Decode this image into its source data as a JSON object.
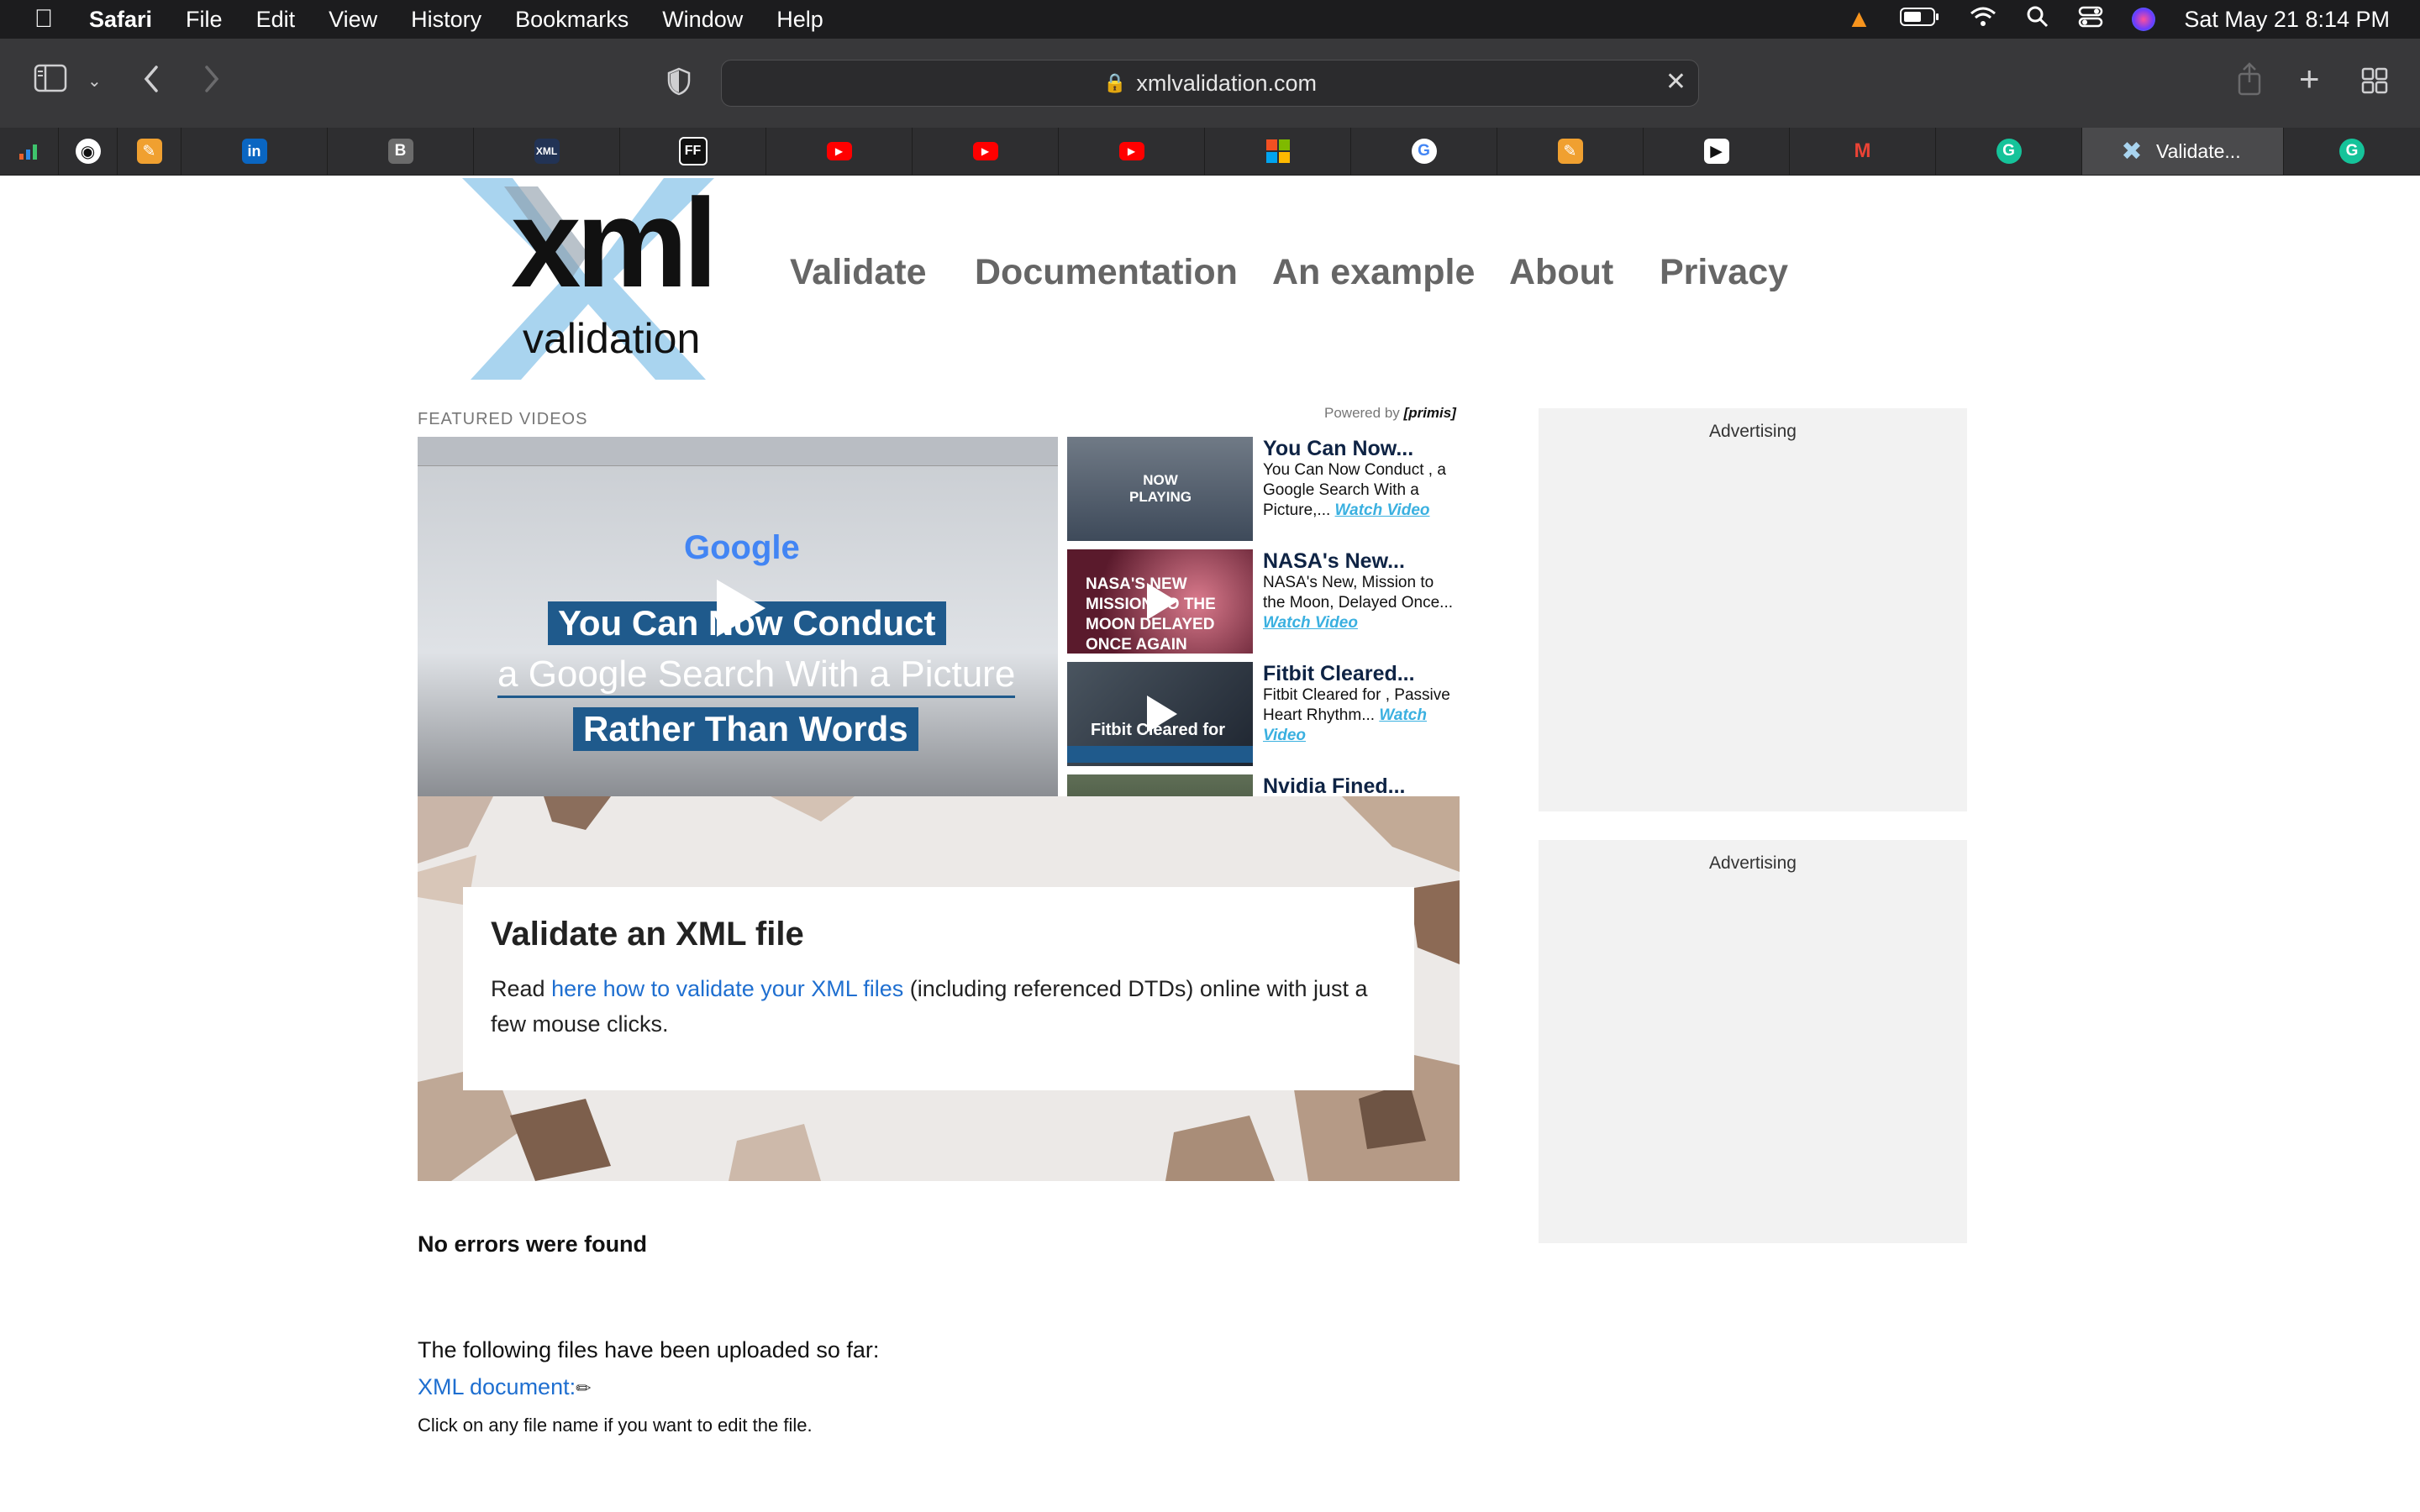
{
  "menubar": {
    "app": "Safari",
    "items": [
      "File",
      "Edit",
      "View",
      "History",
      "Bookmarks",
      "Window",
      "Help"
    ],
    "clock": "Sat May 21  8:14 PM"
  },
  "browser": {
    "url": "xmlvalidation.com",
    "active_tab_label": "Validate..."
  },
  "tabs": [
    {
      "icon": "chart-icon",
      "color": "#e8622d"
    },
    {
      "icon": "github-icon",
      "color": "#ffffff"
    },
    {
      "icon": "notepad-icon",
      "color": "#f0a030"
    },
    {
      "icon": "linkedin-icon",
      "color": "#0a66c2"
    },
    {
      "icon": "b-icon",
      "color": "#6b6b6b"
    },
    {
      "icon": "xml-icon",
      "color": "#223355"
    },
    {
      "icon": "ff-icon",
      "color": "#111111"
    },
    {
      "icon": "youtube-icon",
      "color": "#ff0000"
    },
    {
      "icon": "youtube-icon",
      "color": "#ff0000"
    },
    {
      "icon": "youtube-icon",
      "color": "#ff0000"
    },
    {
      "icon": "microsoft-icon",
      "color": "#f25022"
    },
    {
      "icon": "google-icon",
      "color": "#4285f4"
    },
    {
      "icon": "notepad-icon",
      "color": "#f0a030"
    },
    {
      "icon": "playstation-icon",
      "color": "#ffffff"
    },
    {
      "icon": "gmail-icon",
      "color": "#ea4335"
    },
    {
      "icon": "grammarly-icon",
      "color": "#15c39a"
    }
  ],
  "logo": {
    "big": "xml",
    "small": "validation"
  },
  "nav": [
    "Validate",
    "Documentation",
    "An example",
    "About",
    "Privacy"
  ],
  "videos": {
    "section_label": "FEATURED VIDEOS",
    "powered_by": "Powered by",
    "powered_brand": "primis",
    "main": {
      "brand": "Google",
      "line1": "You Can Now Conduct",
      "line2": "a Google Search With a Picture",
      "line3": "Rather Than Words"
    },
    "list": [
      {
        "title": "You Can Now...",
        "desc": "You Can Now Conduct , a Google Search With a Picture,...",
        "watch": "Watch Video",
        "thumb_text": "NOW PLAYING"
      },
      {
        "title": "NASA's New...",
        "desc": "NASA's New, Mission to the Moon, Delayed Once...",
        "watch": "Watch Video",
        "thumb_text": "NASA'S NEW MISSION TO THE MOON DELAYED ONCE AGAIN"
      },
      {
        "title": "Fitbit Cleared...",
        "desc": "Fitbit Cleared for , Passive Heart Rhythm...",
        "watch": "Watch Video",
        "thumb_text": "Fitbit Cleared for"
      },
      {
        "title": "Nvidia Fined...",
        "desc": "",
        "watch": "",
        "thumb_text": ""
      }
    ]
  },
  "hero": {
    "title": "Validate an XML file",
    "text_before": "Read ",
    "link": "here how to validate your XML files",
    "text_after": " (including referenced DTDs) online with just a few mouse clicks."
  },
  "ads": [
    "Advertising",
    "Advertising"
  ],
  "result": {
    "status": "No errors were found",
    "uploaded_label": "The following files have been uploaded so far:",
    "file_link": "XML document:",
    "hint": "Click on any file name if you want to edit the file."
  },
  "colors": {
    "accent_link": "#1f6fd0",
    "nav_text": "#666666",
    "logo_blue": "#a9d4ef"
  }
}
